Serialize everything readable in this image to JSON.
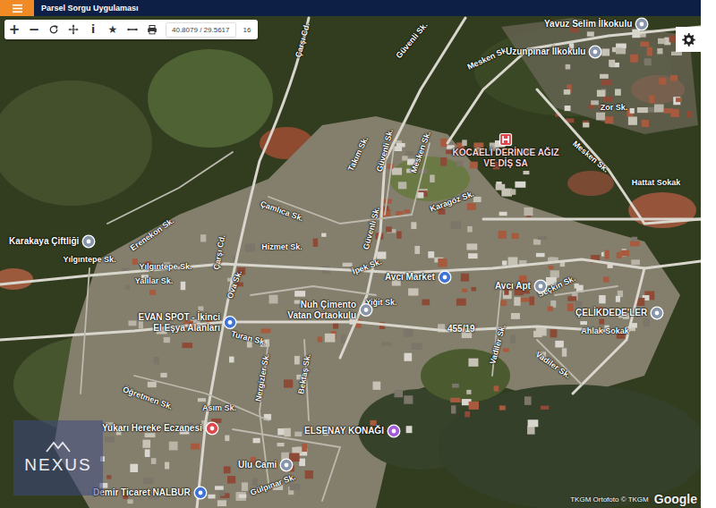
{
  "header": {
    "title": "Parsel Sorgu Uygulaması"
  },
  "toolbar": {
    "zoom_in": "+",
    "zoom_out": "−",
    "info": "i",
    "favorite": "★",
    "coordinates": "40.8079 / 29.5617",
    "zoom_level": "16"
  },
  "map": {
    "streets": [
      "Çarşı Cd.",
      "Güvenli Sk.",
      "Mesken Sk.",
      "Zor Sk.",
      "Mesken Sk.",
      "Hattat Sokak",
      "Takım Sk.",
      "Güvenli Sk.",
      "Mesken Sk.",
      "Karagöz Sk.",
      "Çamlıca Sk.",
      "Erenekon Sk.",
      "Yılgıntepe Sk.",
      "Yılgıntepe Sk.",
      "Hizmet Sk.",
      "Güvenli Sk.",
      "İpek Sk.",
      "Yalılar Sk.",
      "Çarşı Cd.",
      "Ova Sk.",
      "Yiğit Sk.",
      "Seçkin Sk.",
      "Turan Sk.",
      "Ahlak Sokak",
      "Vadiler Sk.",
      "Vadiler Sk.",
      "Öğretmen Sk.",
      "Nergizler Sk.",
      "Bektaş Sk.",
      "Asım Sk.",
      "Gülpınar Sk."
    ],
    "places": [
      {
        "name": "Yavuz Selim İlkokulu",
        "color": "#8796ab",
        "kind": "inline"
      },
      {
        "name": "Uzunpınar İlkokulu",
        "color": "#8796ab",
        "kind": "inline"
      },
      {
        "name": "KOCAELİ DERİNCE AĞIZ VE DİŞ SA",
        "color": "#e0474c",
        "kind": "stacked"
      },
      {
        "name": "Karakaya Çiftliği",
        "color": "#8796ab",
        "kind": "inline"
      },
      {
        "name": "Avcı Market",
        "color": "#3f74d6",
        "kind": "inline"
      },
      {
        "name": "Avcı Apt",
        "color": "#8796ab",
        "kind": "inline"
      },
      {
        "name": "ÇELİKDEDE'LER",
        "color": "#8796ab",
        "kind": "inline"
      },
      {
        "name": "Nuh Çimento Vatan Ortaokulu",
        "color": "#8796ab",
        "kind": "inline"
      },
      {
        "name": "EVAN SPOT - İkinci El Eşya Alanları",
        "color": "#3f74d6",
        "kind": "inline"
      },
      {
        "name": "Yukarı Hereke Eczanesi",
        "color": "#e0474c",
        "kind": "inline"
      },
      {
        "name": "ELSENAY KONAĞI",
        "color": "#a15cd6",
        "kind": "inline"
      },
      {
        "name": "Ulu Cami",
        "color": "#8796ab",
        "kind": "inline"
      },
      {
        "name": "Demir Ticaret NALBUR",
        "color": "#3f74d6",
        "kind": "inline"
      }
    ],
    "parcel": {
      "label": "455/19"
    }
  },
  "watermark": "NEXUS",
  "attribution": {
    "imagery": "TKGM Ortofoto © TKGM",
    "provider": "Google"
  }
}
